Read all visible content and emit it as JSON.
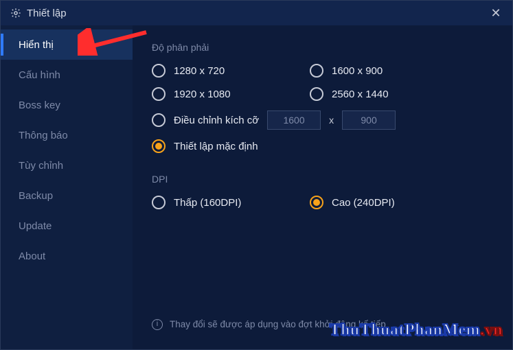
{
  "window": {
    "title": "Thiết lập"
  },
  "sidebar": {
    "items": [
      {
        "label": "Hiển thị",
        "active": true
      },
      {
        "label": "Cấu hình",
        "active": false
      },
      {
        "label": "Boss key",
        "active": false
      },
      {
        "label": "Thông báo",
        "active": false
      },
      {
        "label": "Tùy chỉnh",
        "active": false
      },
      {
        "label": "Backup",
        "active": false
      },
      {
        "label": "Update",
        "active": false
      },
      {
        "label": "About",
        "active": false
      }
    ]
  },
  "resolution": {
    "title": "Độ phân phải",
    "options": [
      {
        "id": "r1280",
        "label": "1280 x 720",
        "selected": false
      },
      {
        "id": "r1600",
        "label": "1600 x 900",
        "selected": false
      },
      {
        "id": "r1920",
        "label": "1920 x 1080",
        "selected": false
      },
      {
        "id": "r2560",
        "label": "2560 x 1440",
        "selected": false
      }
    ],
    "custom": {
      "label": "Điều chỉnh kích cỡ",
      "width": "1600",
      "height": "900",
      "separator": "x",
      "selected": false
    },
    "default": {
      "label": "Thiết lập mặc định",
      "selected": true
    }
  },
  "dpi": {
    "title": "DPI",
    "options": [
      {
        "id": "low",
        "label": "Thấp (160DPI)",
        "selected": false
      },
      {
        "id": "high",
        "label": "Cao (240DPI)",
        "selected": true
      }
    ]
  },
  "footnote": "Thay đổi sẽ được áp dụng vào đợt khởi động kế tiếp",
  "watermark": {
    "main": "ThuThuatPhanMem",
    "suffix": ".vn"
  },
  "colors": {
    "accent": "#f7a21a",
    "bg": "#0d1b3a",
    "sidebarActive": "#17315e",
    "highlight": "#2f7bff",
    "annotationArrow": "#ff2d2d"
  }
}
